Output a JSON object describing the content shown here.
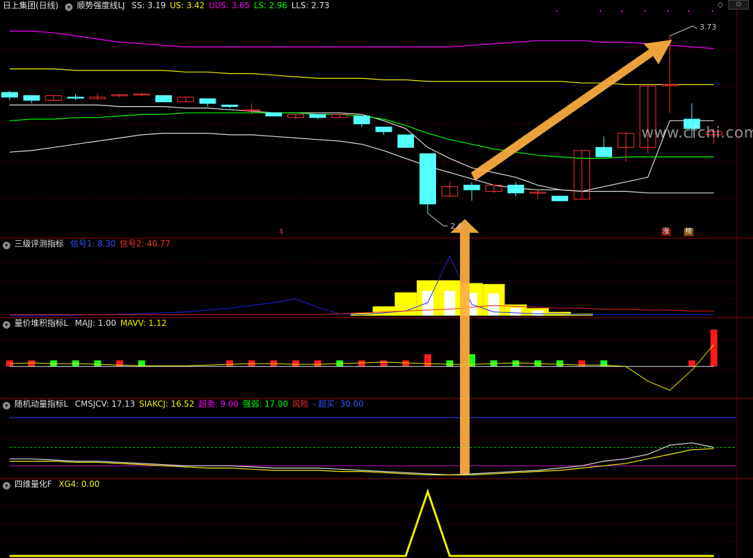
{
  "main": {
    "stock": "日上集团(日线)",
    "indicator": "顺势强度线LJ",
    "values": [
      {
        "label": "SS: 3.19",
        "color": "#e0e0e0"
      },
      {
        "label": "US: 3.42",
        "color": "#f0f000"
      },
      {
        "label": "UUS: 3.65",
        "color": "#ff00ff"
      },
      {
        "label": "LS: 2.96",
        "color": "#00ff00"
      },
      {
        "label": "LLS: 2.73",
        "color": "#e0e0e0"
      }
    ],
    "annotations": {
      "high": "3.73",
      "low": "2.6"
    },
    "markers": {
      "s": "$",
      "zhang": "涨",
      "bang": "榜"
    },
    "watermark": "www.cfchi.com"
  },
  "panel2": {
    "name": "三级评测指标",
    "values": [
      {
        "label": "信号1: 8.30",
        "color": "#3355ff"
      },
      {
        "label": "信号2: 40.77",
        "color": "#ff3333"
      }
    ]
  },
  "panel3": {
    "name": "量价堆积指标L",
    "values": [
      {
        "label": "MAJJ: 1.00",
        "color": "#e0e0e0"
      },
      {
        "label": "MAVV: 1.12",
        "color": "#f0f000"
      }
    ]
  },
  "panel4": {
    "name": "随机动量指标L",
    "values": [
      {
        "label": "CMSJCV: 17.13",
        "color": "#e0e0e0"
      },
      {
        "label": "SIAKCJ: 16.52",
        "color": "#f0f000"
      },
      {
        "label": "超卖: 9.00",
        "color": "#ff00ff"
      },
      {
        "label": "强弱: 17.00",
        "color": "#00ff00"
      },
      {
        "label": "风险",
        "color": "#ff3333"
      },
      {
        "label": "- 超买: 30.00",
        "color": "#3355ff"
      }
    ]
  },
  "panel5": {
    "name": "四维量化F",
    "values": [
      {
        "label": "XG4: 0.00",
        "color": "#f0f000"
      }
    ]
  },
  "colors": {
    "up": "#ff3232",
    "down": "#54ffff",
    "grid": "#8a0000",
    "arrow": "#ffb040"
  },
  "chart_data": [
    {
      "type": "candlestick",
      "title": "顺势强度线LJ",
      "candles": [
        {
          "o": 3.37,
          "c": 3.34,
          "h": 3.38,
          "l": 3.32
        },
        {
          "o": 3.35,
          "c": 3.32,
          "h": 3.35,
          "l": 3.3
        },
        {
          "o": 3.32,
          "c": 3.35,
          "h": 3.35,
          "l": 3.32
        },
        {
          "o": 3.34,
          "c": 3.335,
          "h": 3.36,
          "l": 3.32
        },
        {
          "o": 3.33,
          "c": 3.34,
          "h": 3.36,
          "l": 3.325
        },
        {
          "o": 3.35,
          "c": 3.355,
          "h": 3.36,
          "l": 3.34
        },
        {
          "o": 3.355,
          "c": 3.36,
          "h": 3.37,
          "l": 3.35
        },
        {
          "o": 3.35,
          "c": 3.31,
          "h": 3.35,
          "l": 3.31
        },
        {
          "o": 3.31,
          "c": 3.34,
          "h": 3.34,
          "l": 3.31
        },
        {
          "o": 3.33,
          "c": 3.3,
          "h": 3.33,
          "l": 3.28
        },
        {
          "o": 3.29,
          "c": 3.28,
          "h": 3.29,
          "l": 3.27
        },
        {
          "o": 3.26,
          "c": 3.26,
          "h": 3.3,
          "l": 3.23
        },
        {
          "o": 3.24,
          "c": 3.22,
          "h": 3.24,
          "l": 3.22
        },
        {
          "o": 3.21,
          "c": 3.23,
          "h": 3.23,
          "l": 3.2
        },
        {
          "o": 3.23,
          "c": 3.21,
          "h": 3.23,
          "l": 3.2
        },
        {
          "o": 3.21,
          "c": 3.23,
          "h": 3.23,
          "l": 3.21
        },
        {
          "o": 3.22,
          "c": 3.17,
          "h": 3.22,
          "l": 3.15
        },
        {
          "o": 3.15,
          "c": 3.12,
          "h": 3.15,
          "l": 3.1
        },
        {
          "o": 3.1,
          "c": 3.02,
          "h": 3.1,
          "l": 3.02
        },
        {
          "o": 2.98,
          "c": 2.66,
          "h": 2.98,
          "l": 2.6
        },
        {
          "o": 2.71,
          "c": 2.77,
          "h": 2.8,
          "l": 2.71
        },
        {
          "o": 2.78,
          "c": 2.75,
          "h": 2.8,
          "l": 2.68
        },
        {
          "o": 2.74,
          "c": 2.78,
          "h": 2.78,
          "l": 2.73
        },
        {
          "o": 2.78,
          "c": 2.73,
          "h": 2.8,
          "l": 2.71
        },
        {
          "o": 2.73,
          "c": 2.735,
          "h": 2.75,
          "l": 2.69
        },
        {
          "o": 2.71,
          "c": 2.68,
          "h": 2.71,
          "l": 2.68
        },
        {
          "o": 2.69,
          "c": 3.0,
          "h": 3.0,
          "l": 2.69
        },
        {
          "o": 3.02,
          "c": 2.96,
          "h": 3.09,
          "l": 2.96
        },
        {
          "o": 3.02,
          "c": 3.11,
          "h": 3.11,
          "l": 2.93
        },
        {
          "o": 3.02,
          "c": 3.41,
          "h": 3.41,
          "l": 2.98
        },
        {
          "o": 3.42,
          "c": 3.42,
          "h": 3.73,
          "l": 3.24
        },
        {
          "o": 3.2,
          "c": 3.14,
          "h": 3.3,
          "l": 3.08
        },
        {
          "o": 3.1,
          "c": 3.12,
          "h": 3.14,
          "l": 3.04
        }
      ],
      "series": [
        {
          "name": "SS",
          "color": "#e0e0e0",
          "values": [
            3.29,
            3.29,
            3.29,
            3.29,
            3.29,
            3.28,
            3.28,
            3.28,
            3.27,
            3.27,
            3.26,
            3.25,
            3.24,
            3.24,
            3.24,
            3.24,
            3.23,
            3.19,
            3.14,
            3.02,
            2.95,
            2.89,
            2.86,
            2.83,
            2.78,
            2.75,
            2.74,
            2.77,
            2.8,
            2.83,
            3.19,
            3.19,
            3.19
          ]
        },
        {
          "name": "US",
          "color": "#f0f000",
          "values": [
            3.52,
            3.52,
            3.52,
            3.51,
            3.51,
            3.51,
            3.51,
            3.51,
            3.5,
            3.5,
            3.49,
            3.49,
            3.48,
            3.47,
            3.46,
            3.46,
            3.46,
            3.45,
            3.45,
            3.44,
            3.44,
            3.44,
            3.44,
            3.44,
            3.44,
            3.44,
            3.43,
            3.43,
            3.42,
            3.42,
            3.42,
            3.42,
            3.42
          ]
        },
        {
          "name": "UUS",
          "color": "#ff00ff",
          "values": [
            3.76,
            3.76,
            3.75,
            3.73,
            3.71,
            3.69,
            3.68,
            3.67,
            3.66,
            3.66,
            3.66,
            3.66,
            3.66,
            3.66,
            3.66,
            3.66,
            3.66,
            3.66,
            3.66,
            3.66,
            3.66,
            3.67,
            3.68,
            3.69,
            3.7,
            3.7,
            3.7,
            3.69,
            3.69,
            3.68,
            3.67,
            3.66,
            3.65
          ]
        },
        {
          "name": "LS",
          "color": "#00ff00",
          "values": [
            3.19,
            3.2,
            3.2,
            3.21,
            3.21,
            3.22,
            3.23,
            3.23,
            3.24,
            3.24,
            3.24,
            3.24,
            3.24,
            3.24,
            3.23,
            3.23,
            3.22,
            3.2,
            3.16,
            3.11,
            3.07,
            3.04,
            3.01,
            2.99,
            2.97,
            2.96,
            2.95,
            2.95,
            2.96,
            2.96,
            2.96,
            2.96,
            2.96
          ]
        },
        {
          "name": "LLS",
          "color": "#e0e0e0",
          "values": [
            2.99,
            3.0,
            3.02,
            3.04,
            3.06,
            3.08,
            3.1,
            3.11,
            3.11,
            3.11,
            3.1,
            3.1,
            3.09,
            3.08,
            3.07,
            3.06,
            3.04,
            3.0,
            2.95,
            2.9,
            2.86,
            2.82,
            2.78,
            2.76,
            2.75,
            2.75,
            2.74,
            2.74,
            2.74,
            2.73,
            2.73,
            2.73,
            2.73
          ]
        }
      ],
      "ylim": [
        2.52,
        3.88
      ]
    },
    {
      "type": "line",
      "title": "三级评测指标",
      "x": [
        0,
        1,
        2,
        3,
        4,
        5,
        6,
        7,
        8,
        9,
        10,
        11,
        12,
        13,
        14,
        15,
        16,
        17,
        18,
        19,
        20,
        21,
        22,
        23,
        24,
        25,
        26,
        27,
        28,
        29,
        30,
        31,
        32
      ],
      "series": [
        {
          "name": "信号1",
          "color": "#2222ee",
          "values": [
            0,
            0,
            0,
            0.5,
            1,
            1.5,
            2,
            3,
            4,
            6,
            8,
            11,
            14,
            18,
            9,
            2,
            1,
            3,
            5,
            14,
            64,
            12,
            4,
            3,
            2,
            2,
            1,
            1,
            1,
            1,
            1,
            1,
            1
          ]
        },
        {
          "name": "信号2",
          "color": "#ee2222",
          "values": [
            1,
            1,
            1,
            1,
            1,
            1,
            1,
            1,
            1,
            1,
            1,
            1,
            1,
            1,
            1,
            2,
            3,
            4,
            5,
            6,
            7,
            9,
            11,
            10,
            9,
            8,
            8,
            7,
            7,
            6,
            6,
            5,
            5
          ]
        }
      ],
      "bars": [
        0,
        0,
        0,
        0,
        0,
        0,
        0,
        0,
        0,
        0,
        0,
        0,
        0,
        0,
        0,
        0,
        3,
        10,
        25,
        38,
        38,
        35,
        34,
        12,
        8,
        4,
        2,
        0,
        0,
        0,
        0,
        0,
        0
      ],
      "ylim": [
        0,
        70
      ]
    },
    {
      "type": "bar",
      "title": "量价堆积指标L",
      "values": [
        1,
        1,
        -1,
        -1,
        -1,
        1,
        -1,
        0,
        0,
        0,
        1,
        1,
        1,
        1,
        1,
        -1,
        1,
        1,
        1,
        1,
        -1,
        -1,
        -1,
        -1,
        -1,
        -1,
        1,
        -1,
        0,
        0,
        0,
        1,
        2
      ],
      "series": [
        {
          "name": "MAJJ",
          "color": "#e0e0e0",
          "values": [
            1.0,
            1.0,
            1.0,
            1.0,
            1.0,
            1.0,
            1.0,
            1.0,
            1.0,
            1.0,
            1.0,
            1.0,
            1.0,
            1.0,
            1.0,
            1.0,
            1.0,
            1.0,
            1.0,
            1.0,
            1.0,
            1.0,
            1.0,
            1.0,
            1.0,
            1.0,
            1.0,
            1.0,
            1.0,
            1.0,
            1.0,
            1.0,
            1.0
          ]
        },
        {
          "name": "MAVV",
          "color": "#f0f000",
          "values": [
            1.08,
            1.1,
            1.08,
            1.08,
            1.06,
            1.04,
            1.02,
            1.02,
            1.02,
            1.04,
            1.06,
            1.08,
            1.08,
            1.06,
            1.06,
            1.08,
            1.1,
            1.12,
            1.1,
            1.08,
            1.06,
            1.06,
            1.08,
            1.1,
            1.08,
            1.06,
            1.04,
            1.04,
            1.0,
            0.6,
            0.35,
            0.9,
            1.6
          ]
        }
      ],
      "ylim": [
        0.2,
        2.0
      ]
    },
    {
      "type": "line",
      "title": "随机动量指标L",
      "x": [
        0,
        1,
        2,
        3,
        4,
        5,
        6,
        7,
        8,
        9,
        10,
        11,
        12,
        13,
        14,
        15,
        16,
        17,
        18,
        19,
        20,
        21,
        22,
        23,
        24,
        25,
        26,
        27,
        28,
        29,
        30,
        31,
        32
      ],
      "series": [
        {
          "name": "CMSJCV",
          "color": "#e0e0e0",
          "values": [
            12,
            12,
            11.5,
            11,
            11,
            10.5,
            10,
            9.5,
            9,
            9,
            9,
            8.5,
            8,
            8,
            8,
            7.5,
            7,
            6.5,
            6,
            5.5,
            5,
            5.5,
            6,
            6.5,
            7,
            8,
            9,
            11,
            12,
            14,
            18,
            19,
            17
          ]
        },
        {
          "name": "SIAKCJ",
          "color": "#f0f000",
          "values": [
            11,
            11,
            11,
            10.5,
            10.5,
            10,
            9.5,
            9,
            8.5,
            8,
            8,
            7.5,
            7,
            7,
            7,
            6.5,
            6.5,
            6,
            5.5,
            5,
            5,
            5,
            5.5,
            6,
            6.5,
            7,
            8,
            9,
            10,
            12,
            14,
            16,
            16.5
          ]
        }
      ],
      "ylim": [
        4,
        33
      ]
    },
    {
      "type": "line",
      "title": "四维量化F",
      "x": [
        0,
        1,
        2,
        3,
        4,
        5,
        6,
        7,
        8,
        9,
        10,
        11,
        12,
        13,
        14,
        15,
        16,
        17,
        18,
        19,
        20,
        21,
        22,
        23,
        24,
        25,
        26,
        27,
        28,
        29,
        30,
        31,
        32
      ],
      "series": [
        {
          "name": "XG4",
          "color": "#f0f000",
          "values": [
            0,
            0,
            0,
            0,
            0,
            0,
            0,
            0,
            0,
            0,
            0,
            0,
            0,
            0,
            0,
            0,
            0,
            0,
            0,
            1,
            0,
            0,
            0,
            0,
            0,
            0,
            0,
            0,
            0,
            0,
            0,
            0,
            0
          ]
        }
      ],
      "ylim": [
        0,
        1
      ]
    }
  ]
}
